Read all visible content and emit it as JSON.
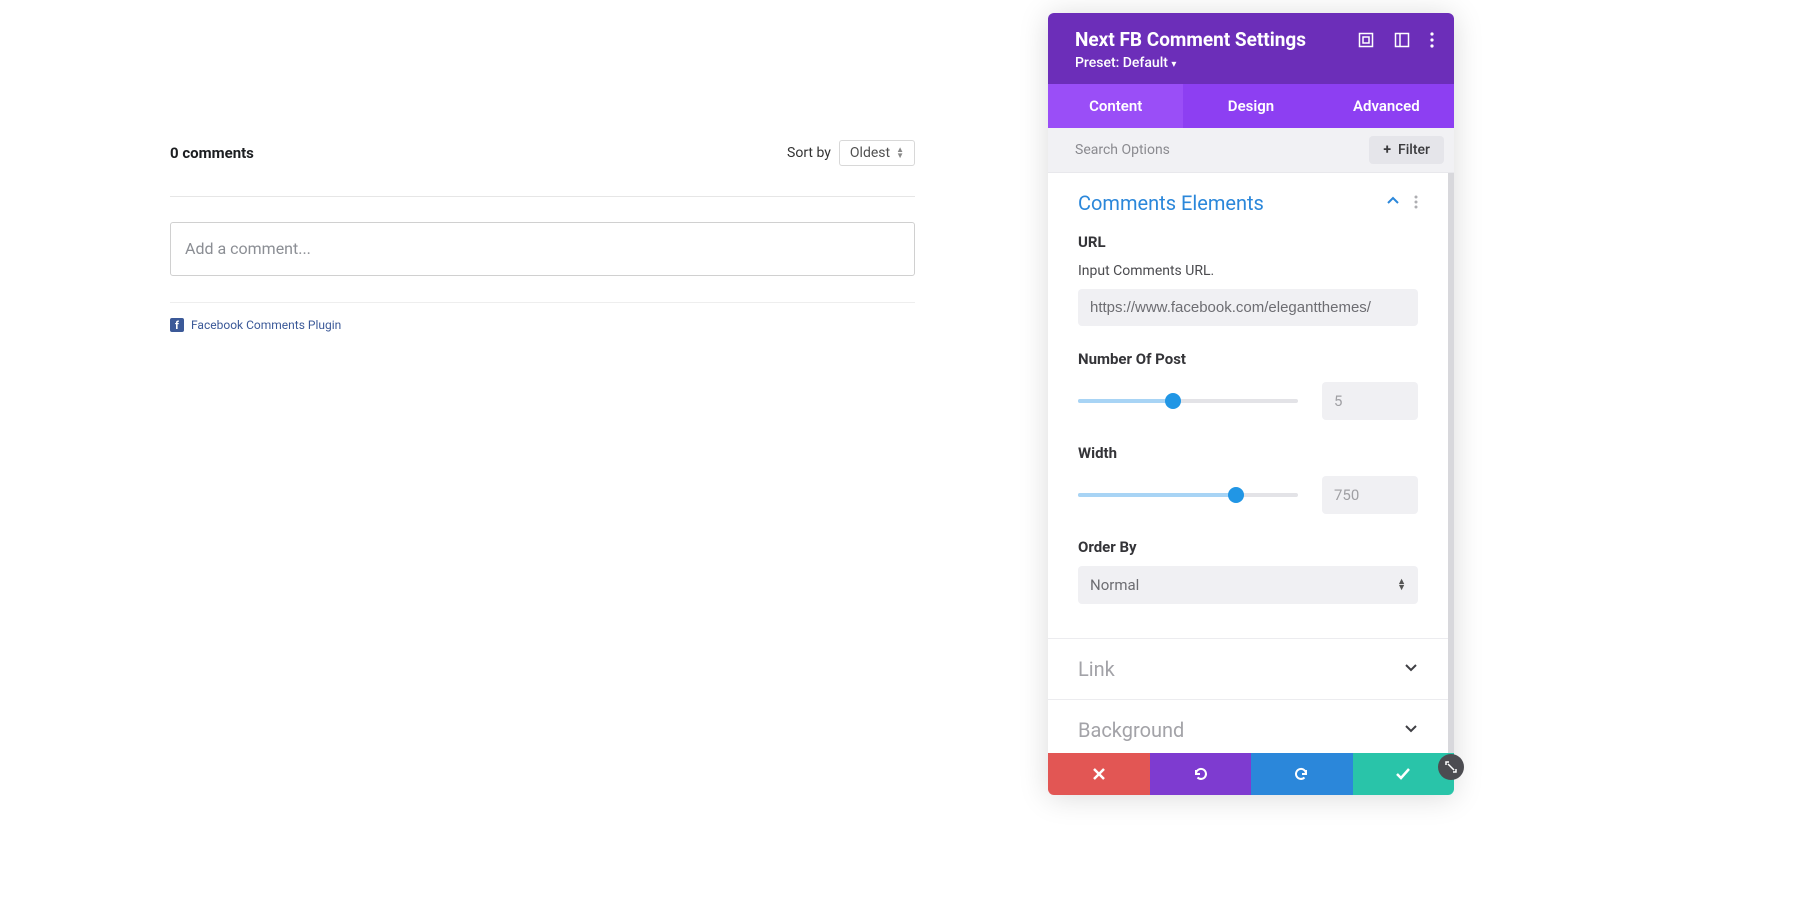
{
  "comments": {
    "count_label": "0 comments",
    "sort_by_label": "Sort by",
    "sort_value": "Oldest",
    "add_placeholder": "Add a comment...",
    "plugin_link": "Facebook Comments Plugin",
    "fb_glyph": "f"
  },
  "panel": {
    "title": "Next FB Comment Settings",
    "preset": "Preset: Default",
    "tabs": {
      "content": "Content",
      "design": "Design",
      "advanced": "Advanced"
    },
    "search_placeholder": "Search Options",
    "filter_label": "Filter",
    "sections": {
      "comments_elements": {
        "title": "Comments Elements",
        "fields": {
          "url_label": "URL",
          "url_sub": "Input Comments URL.",
          "url_value": "https://www.facebook.com/elegantthemes/",
          "num_label": "Number Of Post",
          "num_value": "5",
          "num_percent": 43,
          "width_label": "Width",
          "width_value": "750",
          "width_percent": 72,
          "order_label": "Order By",
          "order_value": "Normal"
        }
      },
      "link": {
        "title": "Link"
      },
      "background": {
        "title": "Background"
      }
    }
  }
}
